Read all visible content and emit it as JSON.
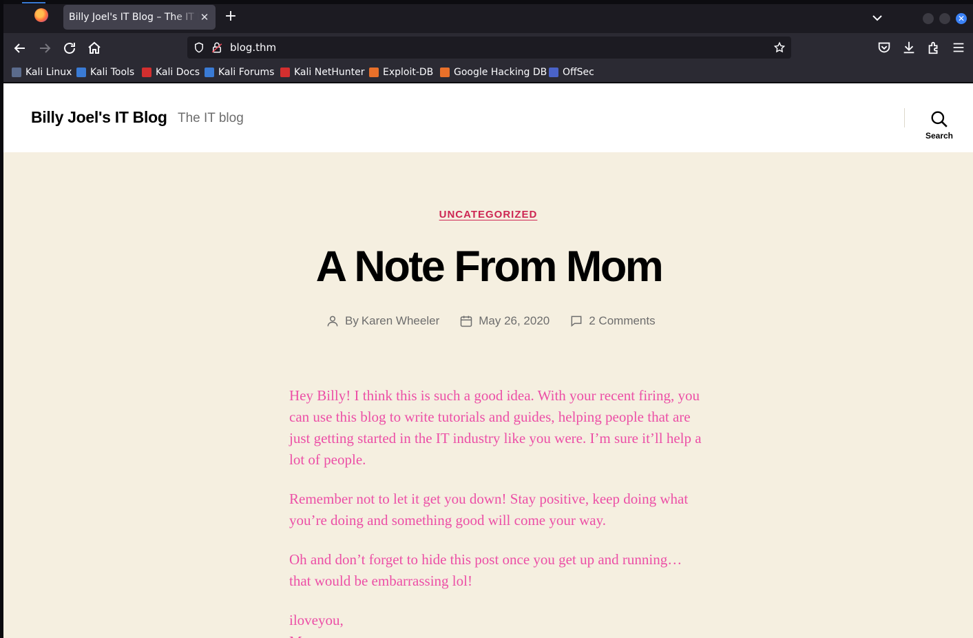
{
  "browser": {
    "tab": {
      "title": "Billy Joel's IT Blog – The IT blog",
      "close": "✕"
    },
    "new_tab": "+",
    "url": "blog.thm",
    "bookmarks": [
      {
        "label": "Kali Linux",
        "color": "#5b6b8c"
      },
      {
        "label": "Kali Tools",
        "color": "#3a7bd5"
      },
      {
        "label": "Kali Docs",
        "color": "#d32f2f"
      },
      {
        "label": "Kali Forums",
        "color": "#3a7bd5"
      },
      {
        "label": "Kali NetHunter",
        "color": "#d32f2f"
      },
      {
        "label": "Exploit-DB",
        "color": "#e8702a"
      },
      {
        "label": "Google Hacking DB",
        "color": "#e8702a"
      },
      {
        "label": "OffSec",
        "color": "#4a63c8"
      }
    ]
  },
  "site": {
    "title": "Billy Joel's IT Blog",
    "tagline": "The IT blog",
    "search_label": "Search"
  },
  "post": {
    "category": "UNCATEGORIZED",
    "title": "A Note From Mom",
    "by": "By",
    "author": "Karen Wheeler",
    "date": "May 26, 2020",
    "comments": "2 Comments",
    "paragraphs": [
      "Hey Billy!  I think this is such a good idea.  With your recent firing, you can use this blog to write tutorials and guides, helping people that are just getting started in the IT industry like you were.  I’m sure it’ll help a lot of people.",
      "Remember not to let it get you down!  Stay positive, keep doing what you’re doing and something good will come your way.",
      "Oh and don’t forget to hide this post once you get up and running… that would be embarrassing lol!",
      "iloveyou,",
      "Mom"
    ]
  },
  "colors": {
    "accent": "#cd2653",
    "body_text": "#ec4fa6",
    "page_bg": "#f5efe0"
  }
}
